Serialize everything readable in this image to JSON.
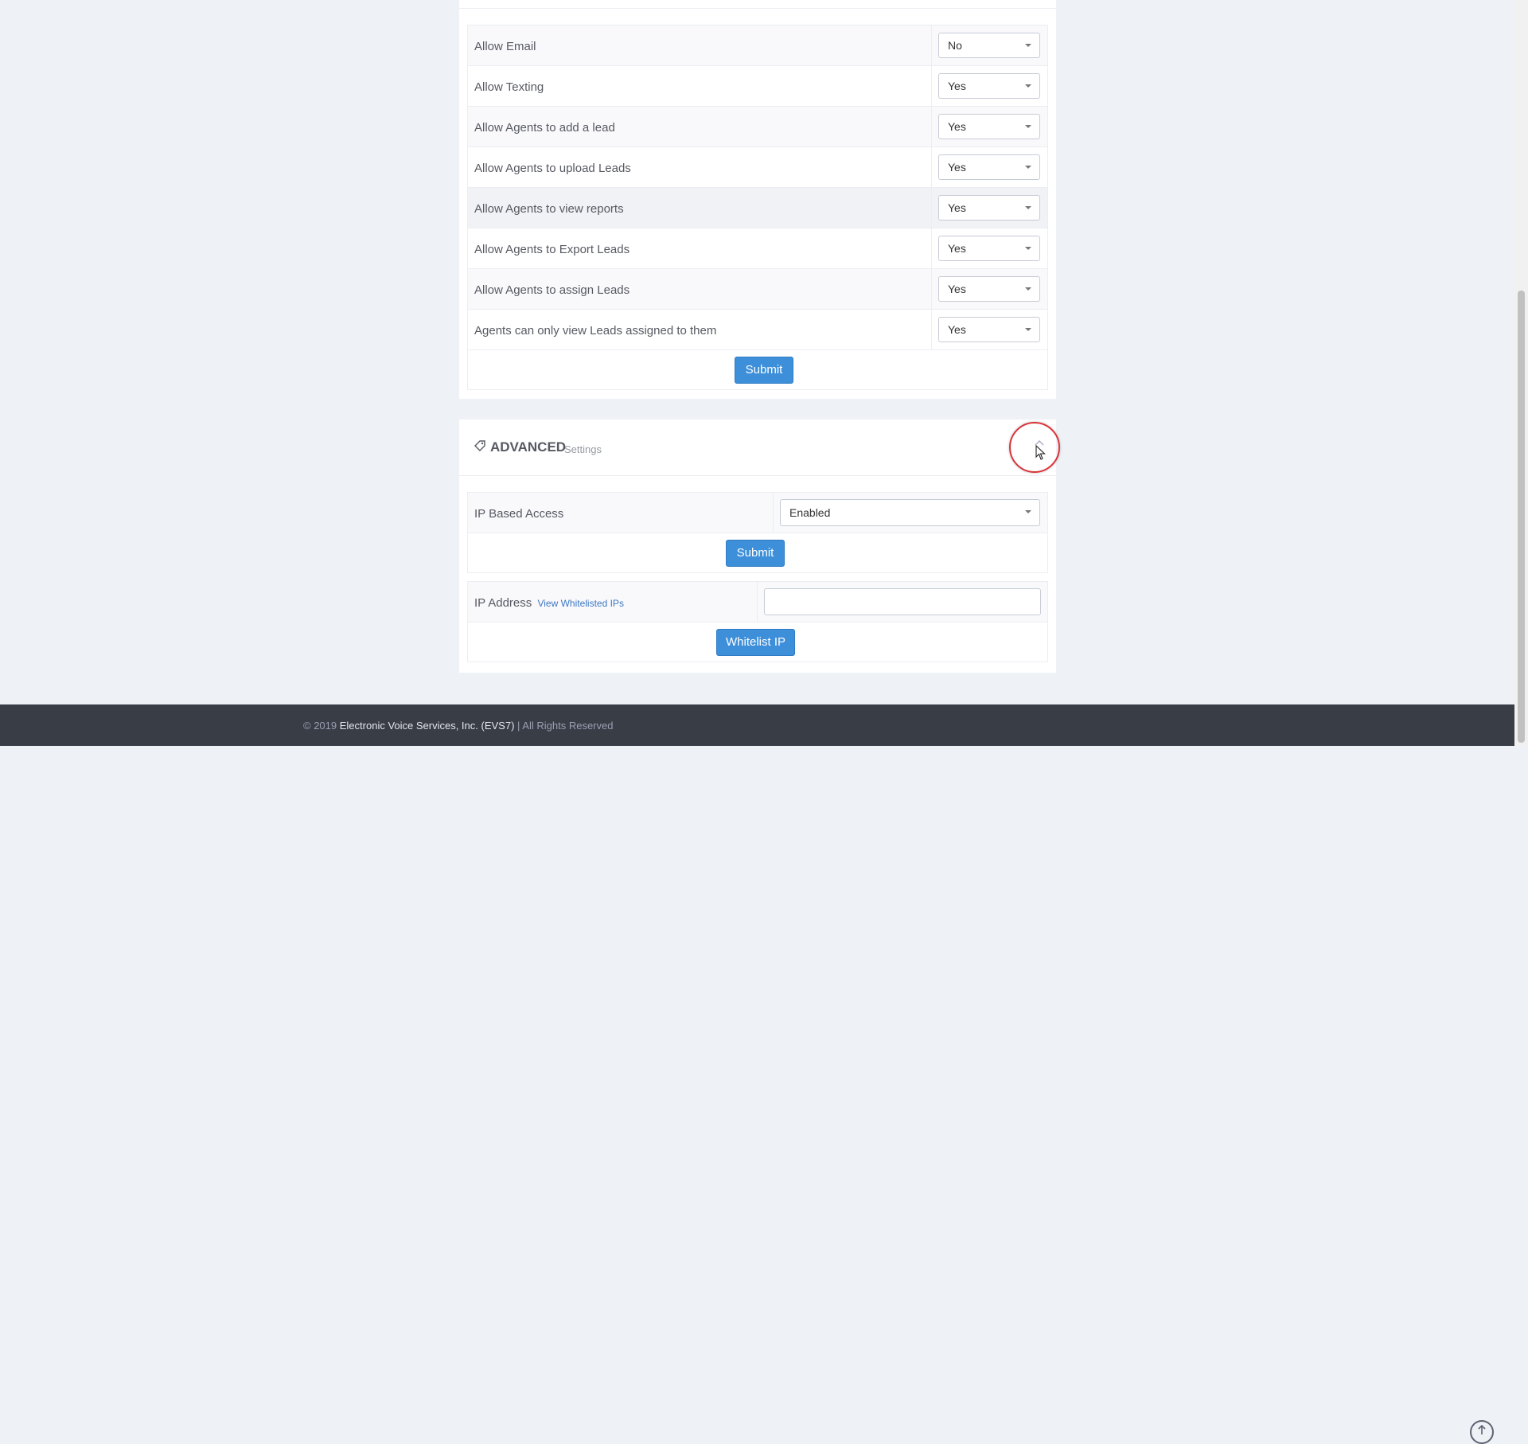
{
  "permissions": {
    "rows": [
      {
        "label": "Allow Email",
        "value": "No"
      },
      {
        "label": "Allow Texting",
        "value": "Yes"
      },
      {
        "label": "Allow Agents to add a lead",
        "value": "Yes"
      },
      {
        "label": "Allow Agents to upload Leads",
        "value": "Yes"
      },
      {
        "label": "Allow Agents to view reports",
        "value": "Yes"
      },
      {
        "label": "Allow Agents to Export Leads",
        "value": "Yes"
      },
      {
        "label": "Allow Agents to assign Leads",
        "value": "Yes"
      },
      {
        "label": "Agents can only view Leads assigned to them",
        "value": "Yes"
      }
    ],
    "submit_label": "Submit"
  },
  "advanced": {
    "title": "ADVANCED",
    "subtitle": "Settings",
    "collapse_icon": "chevron-up-icon",
    "ip_access": {
      "label": "IP Based Access",
      "value": "Enabled",
      "submit_label": "Submit"
    },
    "whitelist": {
      "label": "IP Address",
      "link": "View Whitelisted IPs",
      "input_value": "",
      "button_label": "Whitelist IP"
    }
  },
  "footer": {
    "prefix": "© 2019",
    "company": "Electronic Voice Services, Inc. (EVS7)",
    "suffix": "| All Rights Reserved"
  },
  "colors": {
    "accent": "#3d8fd9",
    "footer_bg": "#393d46",
    "page_bg": "#eef1f5",
    "highlight_ring": "#d9343a"
  }
}
